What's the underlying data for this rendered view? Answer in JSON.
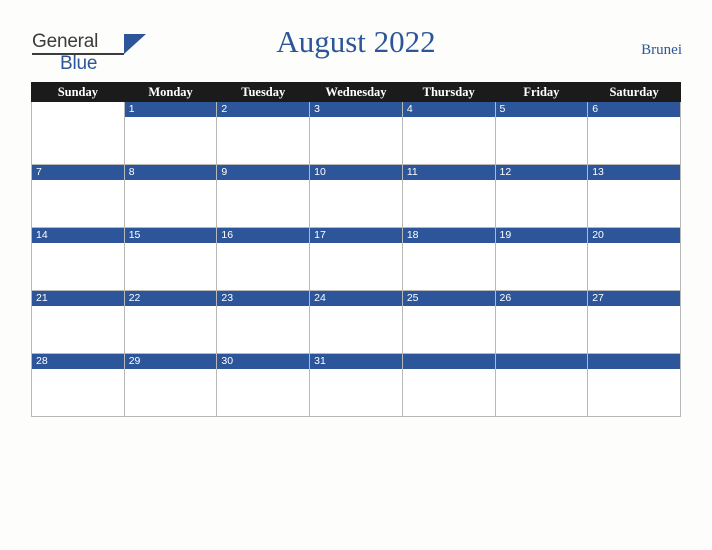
{
  "header": {
    "logo": {
      "word1": "General",
      "word2": "Blue",
      "triangle_color": "#2c5699"
    },
    "title": "August 2022",
    "country": "Brunei"
  },
  "calendar": {
    "weekday_headers": [
      "Sunday",
      "Monday",
      "Tuesday",
      "Wednesday",
      "Thursday",
      "Friday",
      "Saturday"
    ],
    "header_bg": "#1b1b1b",
    "daynum_bg": "#2c5699",
    "weeks": [
      [
        {
          "label": "",
          "type": "blank"
        },
        {
          "label": "1",
          "type": "day"
        },
        {
          "label": "2",
          "type": "day"
        },
        {
          "label": "3",
          "type": "day"
        },
        {
          "label": "4",
          "type": "day"
        },
        {
          "label": "5",
          "type": "day"
        },
        {
          "label": "6",
          "type": "day"
        }
      ],
      [
        {
          "label": "7",
          "type": "day"
        },
        {
          "label": "8",
          "type": "day"
        },
        {
          "label": "9",
          "type": "day"
        },
        {
          "label": "10",
          "type": "day"
        },
        {
          "label": "11",
          "type": "day"
        },
        {
          "label": "12",
          "type": "day"
        },
        {
          "label": "13",
          "type": "day"
        }
      ],
      [
        {
          "label": "14",
          "type": "day"
        },
        {
          "label": "15",
          "type": "day"
        },
        {
          "label": "16",
          "type": "day"
        },
        {
          "label": "17",
          "type": "day"
        },
        {
          "label": "18",
          "type": "day"
        },
        {
          "label": "19",
          "type": "day"
        },
        {
          "label": "20",
          "type": "day"
        }
      ],
      [
        {
          "label": "21",
          "type": "day"
        },
        {
          "label": "22",
          "type": "day"
        },
        {
          "label": "23",
          "type": "day"
        },
        {
          "label": "24",
          "type": "day"
        },
        {
          "label": "25",
          "type": "day"
        },
        {
          "label": "26",
          "type": "day"
        },
        {
          "label": "27",
          "type": "day"
        }
      ],
      [
        {
          "label": "28",
          "type": "day"
        },
        {
          "label": "29",
          "type": "day"
        },
        {
          "label": "30",
          "type": "day"
        },
        {
          "label": "31",
          "type": "day"
        },
        {
          "label": "",
          "type": "empty"
        },
        {
          "label": "",
          "type": "empty"
        },
        {
          "label": "",
          "type": "empty"
        }
      ]
    ]
  }
}
